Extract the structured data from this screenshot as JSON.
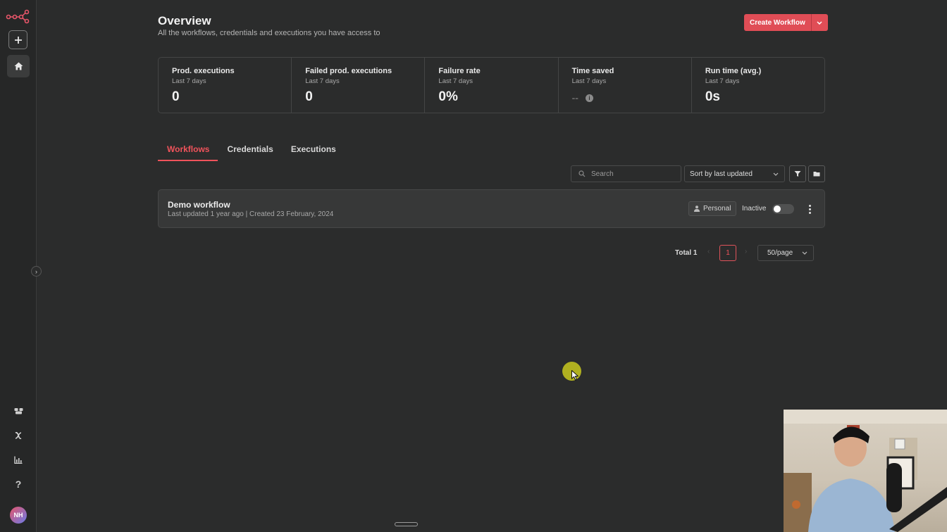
{
  "sidebar": {
    "items": [
      {
        "name": "add",
        "icon": "plus-icon"
      },
      {
        "name": "home",
        "icon": "home-icon"
      },
      {
        "name": "templates",
        "icon": "templates-icon"
      },
      {
        "name": "variables",
        "icon": "variables-icon"
      },
      {
        "name": "insights",
        "icon": "chart-icon"
      },
      {
        "name": "help",
        "icon": "help-icon"
      }
    ],
    "avatar_initials": "NH"
  },
  "header": {
    "title": "Overview",
    "subtitle": "All the workflows, credentials and executions you have access to",
    "create_label": "Create Workflow"
  },
  "stats": [
    {
      "title": "Prod. executions",
      "period": "Last 7 days",
      "value": "0"
    },
    {
      "title": "Failed prod. executions",
      "period": "Last 7 days",
      "value": "0"
    },
    {
      "title": "Failure rate",
      "period": "Last 7 days",
      "value": "0%"
    },
    {
      "title": "Time saved",
      "period": "Last 7 days",
      "value": "--"
    },
    {
      "title": "Run time (avg.)",
      "period": "Last 7 days",
      "value": "0s"
    }
  ],
  "tabs": [
    {
      "label": "Workflows",
      "active": true
    },
    {
      "label": "Credentials",
      "active": false
    },
    {
      "label": "Executions",
      "active": false
    }
  ],
  "toolbar": {
    "search_placeholder": "Search",
    "sort_value": "Sort by last updated"
  },
  "workflows": [
    {
      "name": "Demo workflow",
      "meta": "Last updated 1 year ago | Created 23 February, 2024",
      "owner": "Personal",
      "status": "Inactive",
      "active": false
    }
  ],
  "pagination": {
    "total": "Total 1",
    "current_page": "1",
    "page_size": "50/page"
  },
  "colors": {
    "accent": "#e04d56",
    "background": "#2b2c2c"
  }
}
